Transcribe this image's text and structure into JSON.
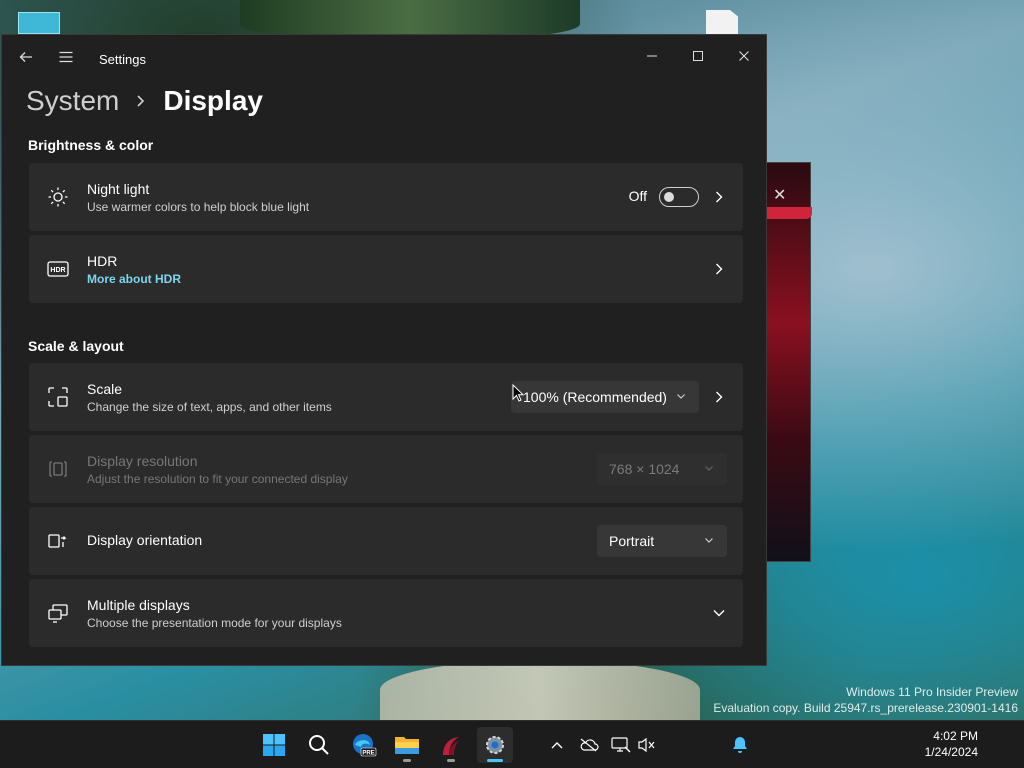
{
  "window": {
    "app_title": "Settings",
    "breadcrumb": {
      "parent": "System",
      "current": "Display"
    },
    "sections": {
      "brightness": "Brightness & color",
      "scale_layout": "Scale & layout"
    },
    "night_light": {
      "title": "Night light",
      "subtitle": "Use warmer colors to help block blue light",
      "state_label": "Off",
      "enabled": false
    },
    "hdr": {
      "title": "HDR",
      "link": "More about HDR"
    },
    "scale": {
      "title": "Scale",
      "subtitle": "Change the size of text, apps, and other items",
      "value": "100% (Recommended)"
    },
    "resolution": {
      "title": "Display resolution",
      "subtitle": "Adjust the resolution to fit your connected display",
      "value": "768 × 1024"
    },
    "orientation": {
      "title": "Display orientation",
      "value": "Portrait"
    },
    "multiple": {
      "title": "Multiple displays",
      "subtitle": "Choose the presentation mode for your displays"
    }
  },
  "desktop": {
    "watermark_line1": "Windows 11 Pro Insider Preview",
    "watermark_line2": "Evaluation copy. Build 25947.rs_prerelease.230901-1416"
  },
  "taskbar": {
    "time": "4:02 PM",
    "date": "1/24/2024",
    "apps": [
      "start-icon",
      "search-icon",
      "edge-preview-icon",
      "file-explorer-icon",
      "app-icon",
      "settings-icon"
    ],
    "edge_badge": "PRE"
  },
  "colors": {
    "accent": "#4cc2ff",
    "link": "#7fd4f0",
    "card": "#2b2b2b",
    "window": "#202020"
  }
}
